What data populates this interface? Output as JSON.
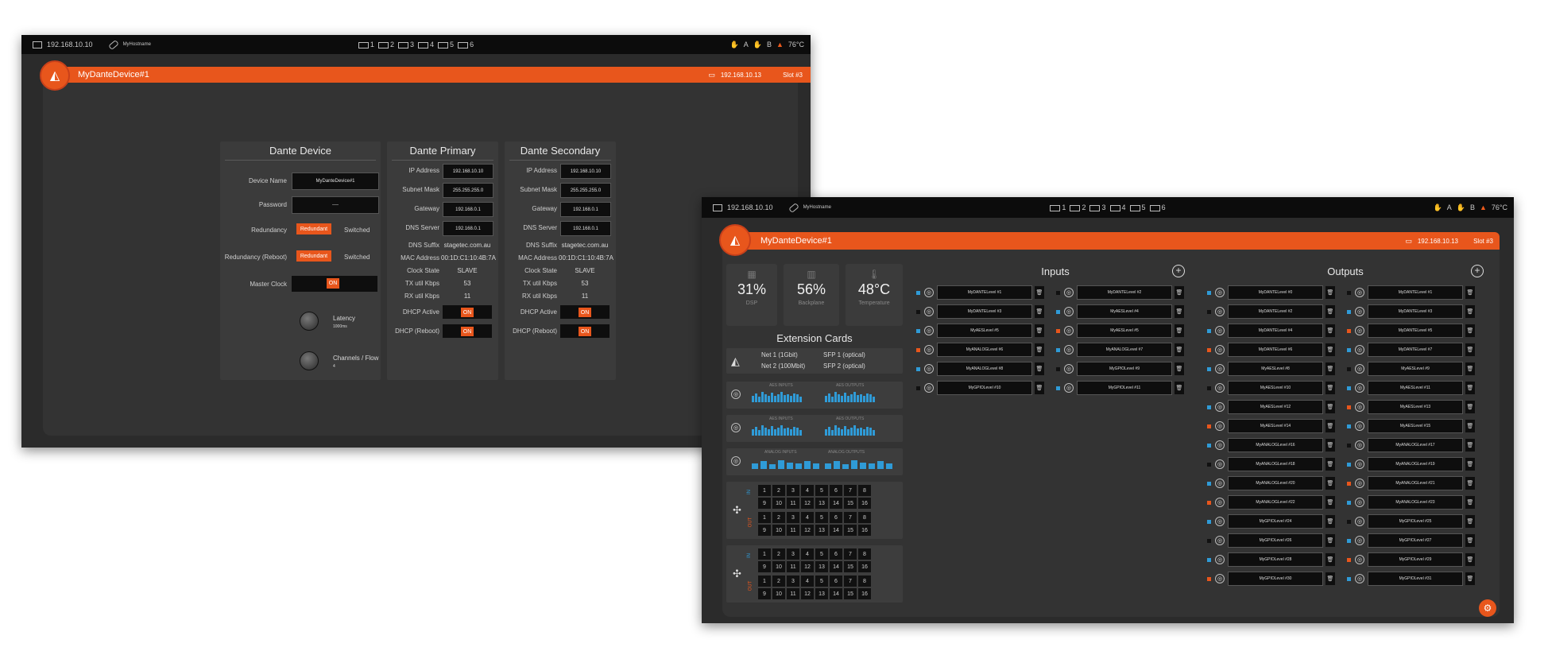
{
  "colors": {
    "accent": "#e8561c",
    "background": "#2b2b2b",
    "blue": "#2f9bd7",
    "topbar": "#0c0c0c"
  },
  "topbar": {
    "ip": "192.168.10.10",
    "hostname": "MyHostname",
    "slots": [
      "1",
      "2",
      "3",
      "4",
      "5",
      "6"
    ],
    "status_a": "A",
    "status_b": "B",
    "temperature": "76°C"
  },
  "header": {
    "device_name": "MyDanteDevice#1",
    "ip": "192.168.10.13",
    "slot": "Slot #3"
  },
  "dante_device": {
    "title": "Dante Device",
    "device_name_label": "Device Name",
    "device_name_value": "MyDanteDevice#1",
    "password_label": "Password",
    "password_value": "----",
    "redundancy_label": "Redundancy",
    "redundancy_reboot_label": "Redundancy (Reboot)",
    "redundant": "Redundant",
    "switched": "Switched",
    "master_clock_label": "Master Clock",
    "on": "ON",
    "latency_label": "Latency",
    "latency_value": "1000ms",
    "channels_label": "Channels / Flow",
    "channels_value": "4"
  },
  "dante_primary": {
    "title": "Dante Primary",
    "labels": [
      "IP Address",
      "Subnet Mask",
      "Gateway",
      "DNS Server",
      "DNS Suffix",
      "MAC Address",
      "Clock State",
      "TX util Kbps",
      "RX util Kbps",
      "DHCP Active",
      "DHCP (Reboot)"
    ],
    "values": [
      "192.168.10.10",
      "255.255.255.0",
      "192.168.0.1",
      "192.168.0.1",
      "stagetec.com.au",
      "00:1D:C1:10:4B:7A",
      "SLAVE",
      "53",
      "11"
    ],
    "on": "ON"
  },
  "dante_secondary": {
    "title": "Dante Secondary",
    "values": [
      "192.168.10.10",
      "255.255.255.0",
      "192.168.0.1",
      "192.168.0.1",
      "stagetec.com.au",
      "00:1D:C1:10:4B:7A",
      "SLAVE",
      "53",
      "11"
    ],
    "on": "ON"
  },
  "stats": [
    {
      "value": "31%",
      "label": "DSP",
      "icon": "chip-icon"
    },
    {
      "value": "56%",
      "label": "Backplane",
      "icon": "backplane-icon"
    },
    {
      "value": "48°C",
      "label": "Temperature",
      "icon": "thermometer-icon"
    }
  ],
  "extension": {
    "title": "Extension Cards",
    "net1": "Net 1 (1Gbit)",
    "net2": "Net 2 (100Mbit)",
    "sfp1": "SFP 1 (optical)",
    "sfp2": "SFP 2 (optical)",
    "aes_inputs": "AES INPUTS",
    "aes_outputs": "AES OUTPUTS",
    "analog_inputs": "ANALOG INPUTS",
    "analog_outputs": "ANALOG OUTPUTS",
    "in": "IN",
    "out": "OUT",
    "row1": [
      "1",
      "2",
      "3",
      "4",
      "5",
      "6",
      "7",
      "8"
    ],
    "row2": [
      "9",
      "10",
      "11",
      "12",
      "13",
      "14",
      "15",
      "16"
    ]
  },
  "inputs": {
    "title": "Inputs",
    "left": [
      "MyDANTELevel #1",
      "MyDANTELevel #3",
      "MyAESLevel #5",
      "MyANALOGLevel #6",
      "MyANALOGLevel #8",
      "MyGPIOLevel #10"
    ],
    "right": [
      "MyDANTELevel #2",
      "MyAESLevel #4",
      "MyAESLevel #5",
      "MyANALOGLevel #7",
      "MyGPIOLevel #9",
      "MyGPIOLevel #11"
    ]
  },
  "outputs": {
    "title": "Outputs",
    "left": [
      "MyDANTELevel #0",
      "MyDANTELevel #2",
      "MyDANTELevel #4",
      "MyDANTELevel #6",
      "MyAESLevel #8",
      "MyAESLevel #10",
      "MyAESLevel #12",
      "MyAESLevel #14",
      "MyANALOGLevel #16",
      "MyANALOGLevel #18",
      "MyANALOGLevel #20",
      "MyANALOGLevel #22",
      "MyGPIOLevel #24",
      "MyGPIOLevel #26",
      "MyGPIOLevel #28",
      "MyGPIOLevel #30"
    ],
    "right": [
      "MyDANTELevel #1",
      "MyDANTELevel #3",
      "MyDANTELevel #5",
      "MyDANTELevel #7",
      "MyAESLevel #9",
      "MyAESLevel #11",
      "MyAESLevel #13",
      "MyAESLevel #15",
      "MyANALOGLevel #17",
      "MyANALOGLevel #19",
      "MyANALOGLevel #21",
      "MyANALOGLevel #23",
      "MyGPIOLevel #25",
      "MyGPIOLevel #27",
      "MyGPIOLevel #29",
      "MyGPIOLevel #31"
    ]
  }
}
